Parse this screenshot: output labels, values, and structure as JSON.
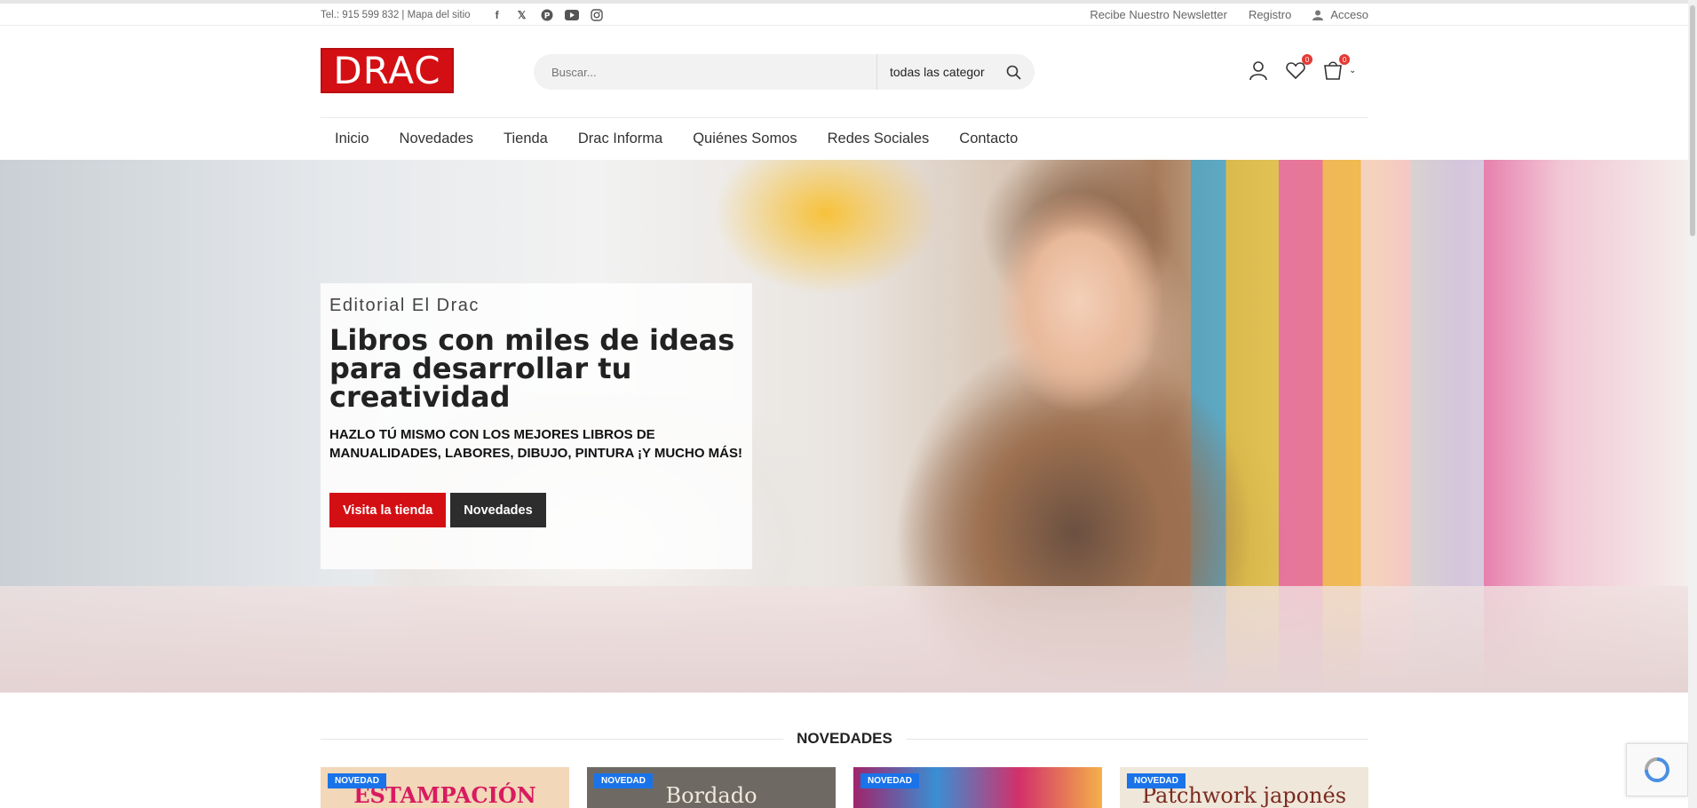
{
  "topbar": {
    "contact": "Tel.: 915 599 832 | Mapa del sitio",
    "social_icons": [
      "facebook-icon",
      "x-icon",
      "pinterest-icon",
      "youtube-icon",
      "instagram-icon"
    ],
    "newsletter": "Recibe Nuestro Newsletter",
    "register": "Registro",
    "login": "Acceso"
  },
  "header": {
    "logo_text": "DRAC",
    "search_placeholder": "Buscar...",
    "category_value": "todas las categor",
    "wishlist_count": "0",
    "cart_count": "0"
  },
  "nav": {
    "items": [
      "Inicio",
      "Novedades",
      "Tienda",
      "Drac Informa",
      "Quiénes Somos",
      "Redes Sociales",
      "Contacto"
    ]
  },
  "hero": {
    "kicker": "Editorial El Drac",
    "title": "Libros con miles de ideas para desarrollar tu creatividad",
    "subtitle": "HAZLO TÚ MISMO CON LOS MEJORES LIBROS DE MANUALIDADES, LABORES, DIBUJO, PINTURA ¡Y MUCHO MÁS!",
    "button_primary": "Visita la tienda",
    "button_secondary": "Novedades"
  },
  "section": {
    "title": "NOVEDADES"
  },
  "products": [
    {
      "tag": "NOVEDAD",
      "cover_text": "ESTAMPACIÓN"
    },
    {
      "tag": "NOVEDAD",
      "cover_text": "Bordado"
    },
    {
      "tag": "NOVEDAD",
      "cover_text": ""
    },
    {
      "tag": "NOVEDAD",
      "cover_text": "Patchwork japonés"
    }
  ],
  "colors": {
    "brand_red": "#d40f14",
    "dark_button": "#2d2d2d",
    "tag_blue": "#1a73e8"
  }
}
